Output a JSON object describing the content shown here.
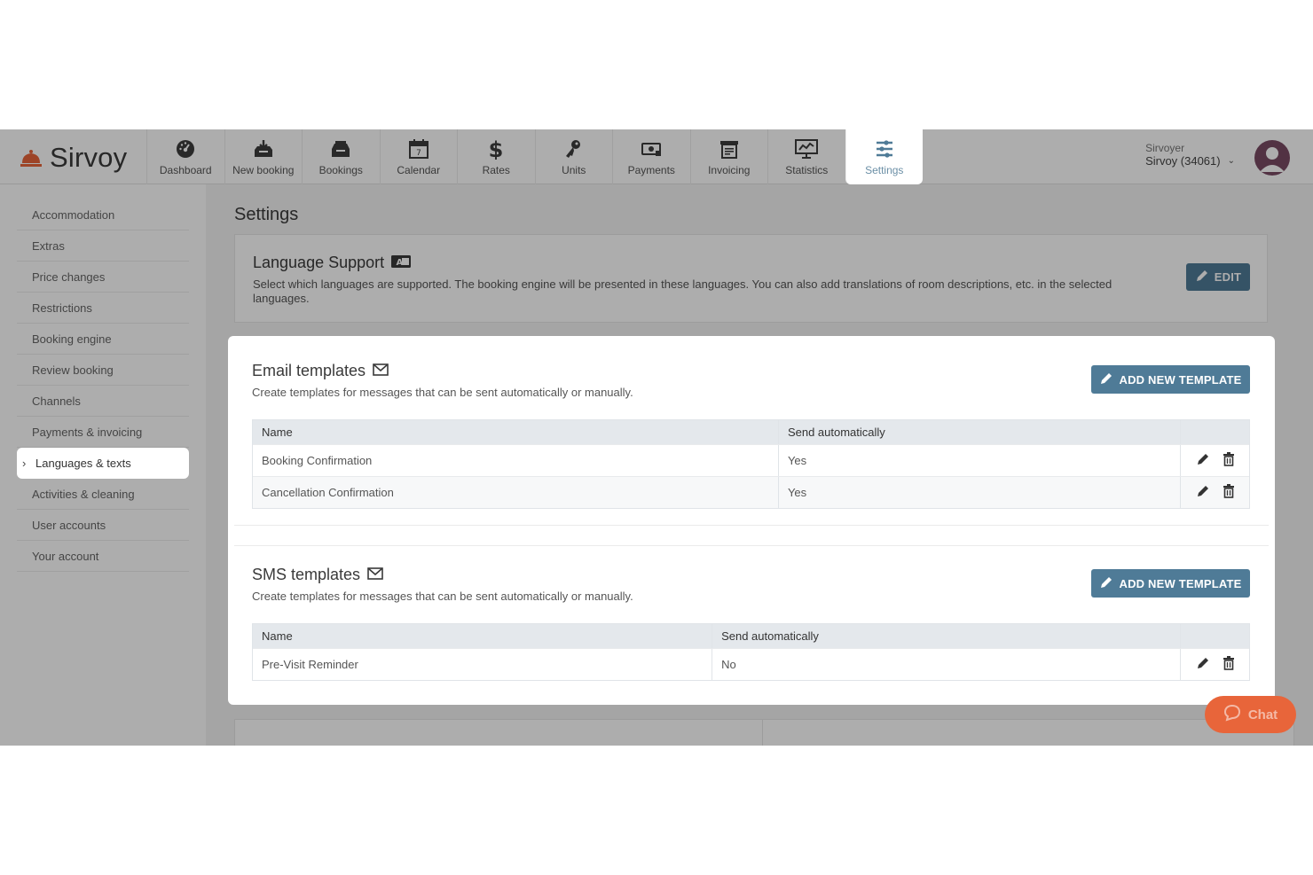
{
  "brand": {
    "name": "Sirvoy",
    "accent": "#e8653a",
    "button": "#4f7b97"
  },
  "nav": [
    {
      "label": "Dashboard",
      "icon": "dashboard-icon"
    },
    {
      "label": "New booking",
      "icon": "inbox-download-icon"
    },
    {
      "label": "Bookings",
      "icon": "inbox-icon"
    },
    {
      "label": "Calendar",
      "icon": "calendar-icon"
    },
    {
      "label": "Rates",
      "icon": "dollar-icon"
    },
    {
      "label": "Units",
      "icon": "key-icon"
    },
    {
      "label": "Payments",
      "icon": "money-icon"
    },
    {
      "label": "Invoicing",
      "icon": "invoice-icon"
    },
    {
      "label": "Statistics",
      "icon": "chart-icon"
    },
    {
      "label": "Settings",
      "icon": "sliders-icon",
      "active": true
    }
  ],
  "account": {
    "name": "Sirvoyer",
    "id": "Sirvoy (34061)"
  },
  "sidebar": {
    "items": [
      {
        "label": "Accommodation"
      },
      {
        "label": "Extras"
      },
      {
        "label": "Price changes"
      },
      {
        "label": "Restrictions"
      },
      {
        "label": "Booking engine"
      },
      {
        "label": "Review booking"
      },
      {
        "label": "Channels"
      },
      {
        "label": "Payments & invoicing"
      },
      {
        "label": "Languages & texts",
        "active": true
      },
      {
        "label": "Activities & cleaning"
      },
      {
        "label": "User accounts"
      },
      {
        "label": "Your account"
      }
    ]
  },
  "page": {
    "title": "Settings"
  },
  "language": {
    "title": "Language Support",
    "description": "Select which languages are supported. The booking engine will be presented in these languages. You can also add translations of room descriptions, etc. in the selected languages.",
    "edit_label": "EDIT"
  },
  "email": {
    "title": "Email templates",
    "description": "Create templates for messages that can be sent automatically or manually.",
    "add_label": "ADD NEW TEMPLATE",
    "columns": [
      "Name",
      "Send automatically"
    ],
    "rows": [
      {
        "name": "Booking Confirmation",
        "auto": "Yes"
      },
      {
        "name": "Cancellation Confirmation",
        "auto": "Yes"
      }
    ]
  },
  "sms": {
    "title": "SMS templates",
    "description": "Create templates for messages that can be sent automatically or manually.",
    "add_label": "ADD NEW TEMPLATE",
    "columns": [
      "Name",
      "Send automatically"
    ],
    "rows": [
      {
        "name": "Pre-Visit Reminder",
        "auto": "No"
      }
    ]
  },
  "chat": {
    "label": "Chat"
  }
}
